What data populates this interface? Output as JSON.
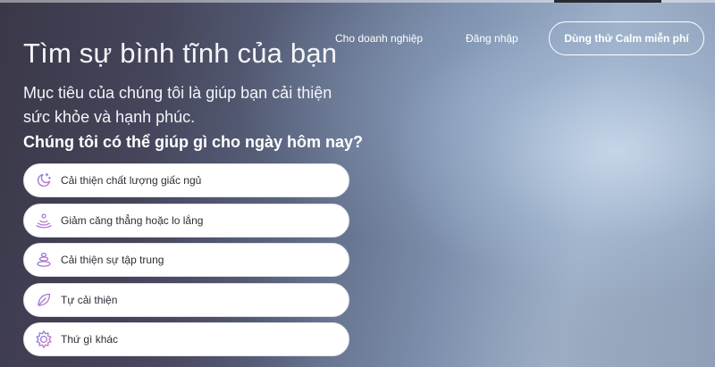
{
  "header": {
    "nav_business": "Cho doanh nghiệp",
    "nav_login": "Đăng nhập",
    "cta_trial": "Dùng thử Calm miễn phí"
  },
  "hero": {
    "title": "Tìm sự bình tĩnh của bạn",
    "subtitle": "Mục tiêu của chúng tôi là giúp bạn cải thiện sức khỏe và hạnh phúc.",
    "question": "Chúng tôi có thể giúp gì cho ngày hôm nay?"
  },
  "options": [
    {
      "label": "Cải thiện chất lượng giấc ngủ",
      "icon": "moon-stars-icon"
    },
    {
      "label": "Giảm căng thẳng hoặc lo lắng",
      "icon": "ripple-icon"
    },
    {
      "label": "Cải thiện sự tập trung",
      "icon": "stacked-stones-icon"
    },
    {
      "label": "Tự cải thiện",
      "icon": "leaf-icon"
    },
    {
      "label": "Thứ gì khác",
      "icon": "sun-icon"
    }
  ],
  "colors": {
    "icon_gradient_start": "#7b7fe0",
    "icon_gradient_end": "#d06fc4",
    "option_text": "#2b2d35",
    "header_text": "#ffffff"
  }
}
